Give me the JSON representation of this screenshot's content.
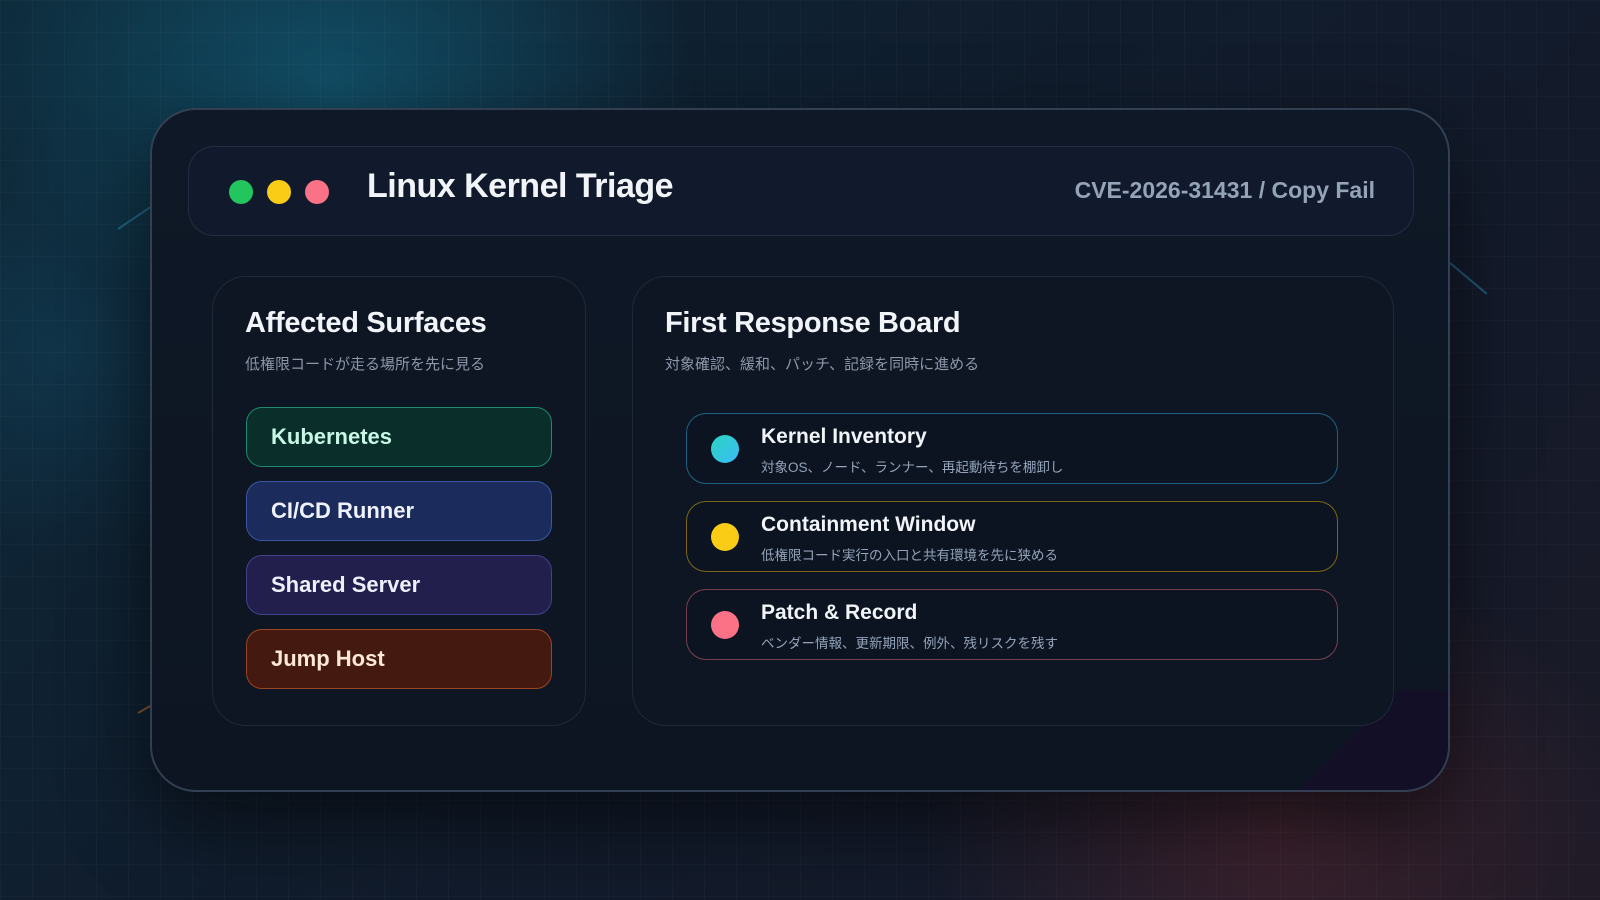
{
  "window": {
    "title": "Linux Kernel Triage",
    "subtitle": "CVE-2026-31431 / Copy Fail",
    "controls": [
      {
        "name": "green-dot",
        "color": "#22c55e"
      },
      {
        "name": "yellow-dot",
        "color": "#facc15"
      },
      {
        "name": "red-dot",
        "color": "#fb7185"
      }
    ]
  },
  "affected": {
    "title": "Affected Surfaces",
    "subtitle": "低権限コードが走る場所を先に見る",
    "items": [
      {
        "label": "Kubernetes",
        "accent": "#1c8a6c"
      },
      {
        "label": "CI/CD Runner",
        "accent": "#3a56a4"
      },
      {
        "label": "Shared Server",
        "accent": "#45408c"
      },
      {
        "label": "Jump Host",
        "accent": "#9a4522"
      }
    ]
  },
  "response": {
    "title": "First Response Board",
    "subtitle": "対象確認、緩和、パッチ、記録を同時に進める",
    "items": [
      {
        "title": "Kernel Inventory",
        "desc": "対象OS、ノード、ランナー、再起動待ちを棚卸し",
        "color": "#38bdf8"
      },
      {
        "title": "Containment Window",
        "desc": "低権限コード実行の入口と共有環境を先に狭める",
        "color": "#facc15"
      },
      {
        "title": "Patch & Record",
        "desc": "ベンダー情報、更新期限、例外、残リスクを残す",
        "color": "#fb7185"
      }
    ]
  }
}
